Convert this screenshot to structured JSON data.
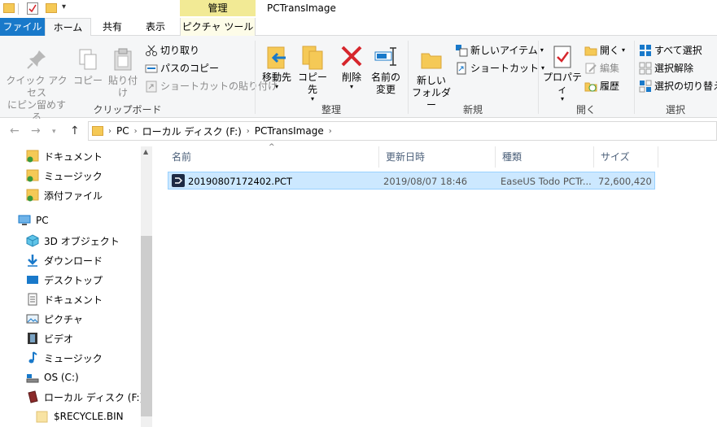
{
  "titlebar": {
    "manage_tab": "管理",
    "window_title": "PCTransImage"
  },
  "tabs": {
    "file": "ファイル",
    "home": "ホーム",
    "share": "共有",
    "view": "表示",
    "picture_tools": "ピクチャ ツール"
  },
  "ribbon": {
    "clipboard": {
      "pin": "クイック アクセス\nにピン留めする",
      "pin_line1": "クイック アクセス",
      "pin_line2": "にピン留めする",
      "copy": "コピー",
      "paste": "貼り付け",
      "cut": "切り取り",
      "copy_path": "パスのコピー",
      "paste_shortcut": "ショートカットの貼り付け",
      "label": "クリップボード"
    },
    "organize": {
      "move_to": "移動先",
      "copy_to": "コピー先",
      "delete": "削除",
      "rename_line1": "名前の",
      "rename_line2": "変更",
      "label": "整理"
    },
    "new": {
      "new_folder_line1": "新しい",
      "new_folder_line2": "フォルダー",
      "new_item": "新しいアイテム",
      "shortcut": "ショートカット",
      "label": "新規"
    },
    "open": {
      "properties": "プロパティ",
      "open": "開く",
      "edit": "編集",
      "history": "履歴",
      "label": "開く"
    },
    "select": {
      "select_all": "すべて選択",
      "select_none": "選択解除",
      "invert": "選択の切り替え",
      "label": "選択"
    }
  },
  "address": {
    "crumbs": [
      "PC",
      "ローカル ディスク (F:)",
      "PCTransImage"
    ]
  },
  "navpane": {
    "items": [
      {
        "label": "ドキュメント"
      },
      {
        "label": "ミュージック"
      },
      {
        "label": "添付ファイル"
      },
      {
        "label": "PC"
      },
      {
        "label": "3D オブジェクト"
      },
      {
        "label": "ダウンロード"
      },
      {
        "label": "デスクトップ"
      },
      {
        "label": "ドキュメント"
      },
      {
        "label": "ピクチャ"
      },
      {
        "label": "ビデオ"
      },
      {
        "label": "ミュージック"
      },
      {
        "label": "OS (C:)"
      },
      {
        "label": "ローカル ディスク (F:)"
      },
      {
        "label": "$RECYCLE.BIN"
      }
    ]
  },
  "filelist": {
    "columns": [
      "名前",
      "更新日時",
      "種類",
      "サイズ"
    ],
    "rows": [
      {
        "name": "20190807172402.PCT",
        "modified": "2019/08/07 18:46",
        "type": "EaseUS Todo PCTr...",
        "size": "72,600,420 ..."
      }
    ]
  },
  "colors": {
    "file_tab": "#1979ca",
    "manage_tab": "#f2ea95",
    "selection": "#cce8ff",
    "delete_red": "#d6262c"
  }
}
